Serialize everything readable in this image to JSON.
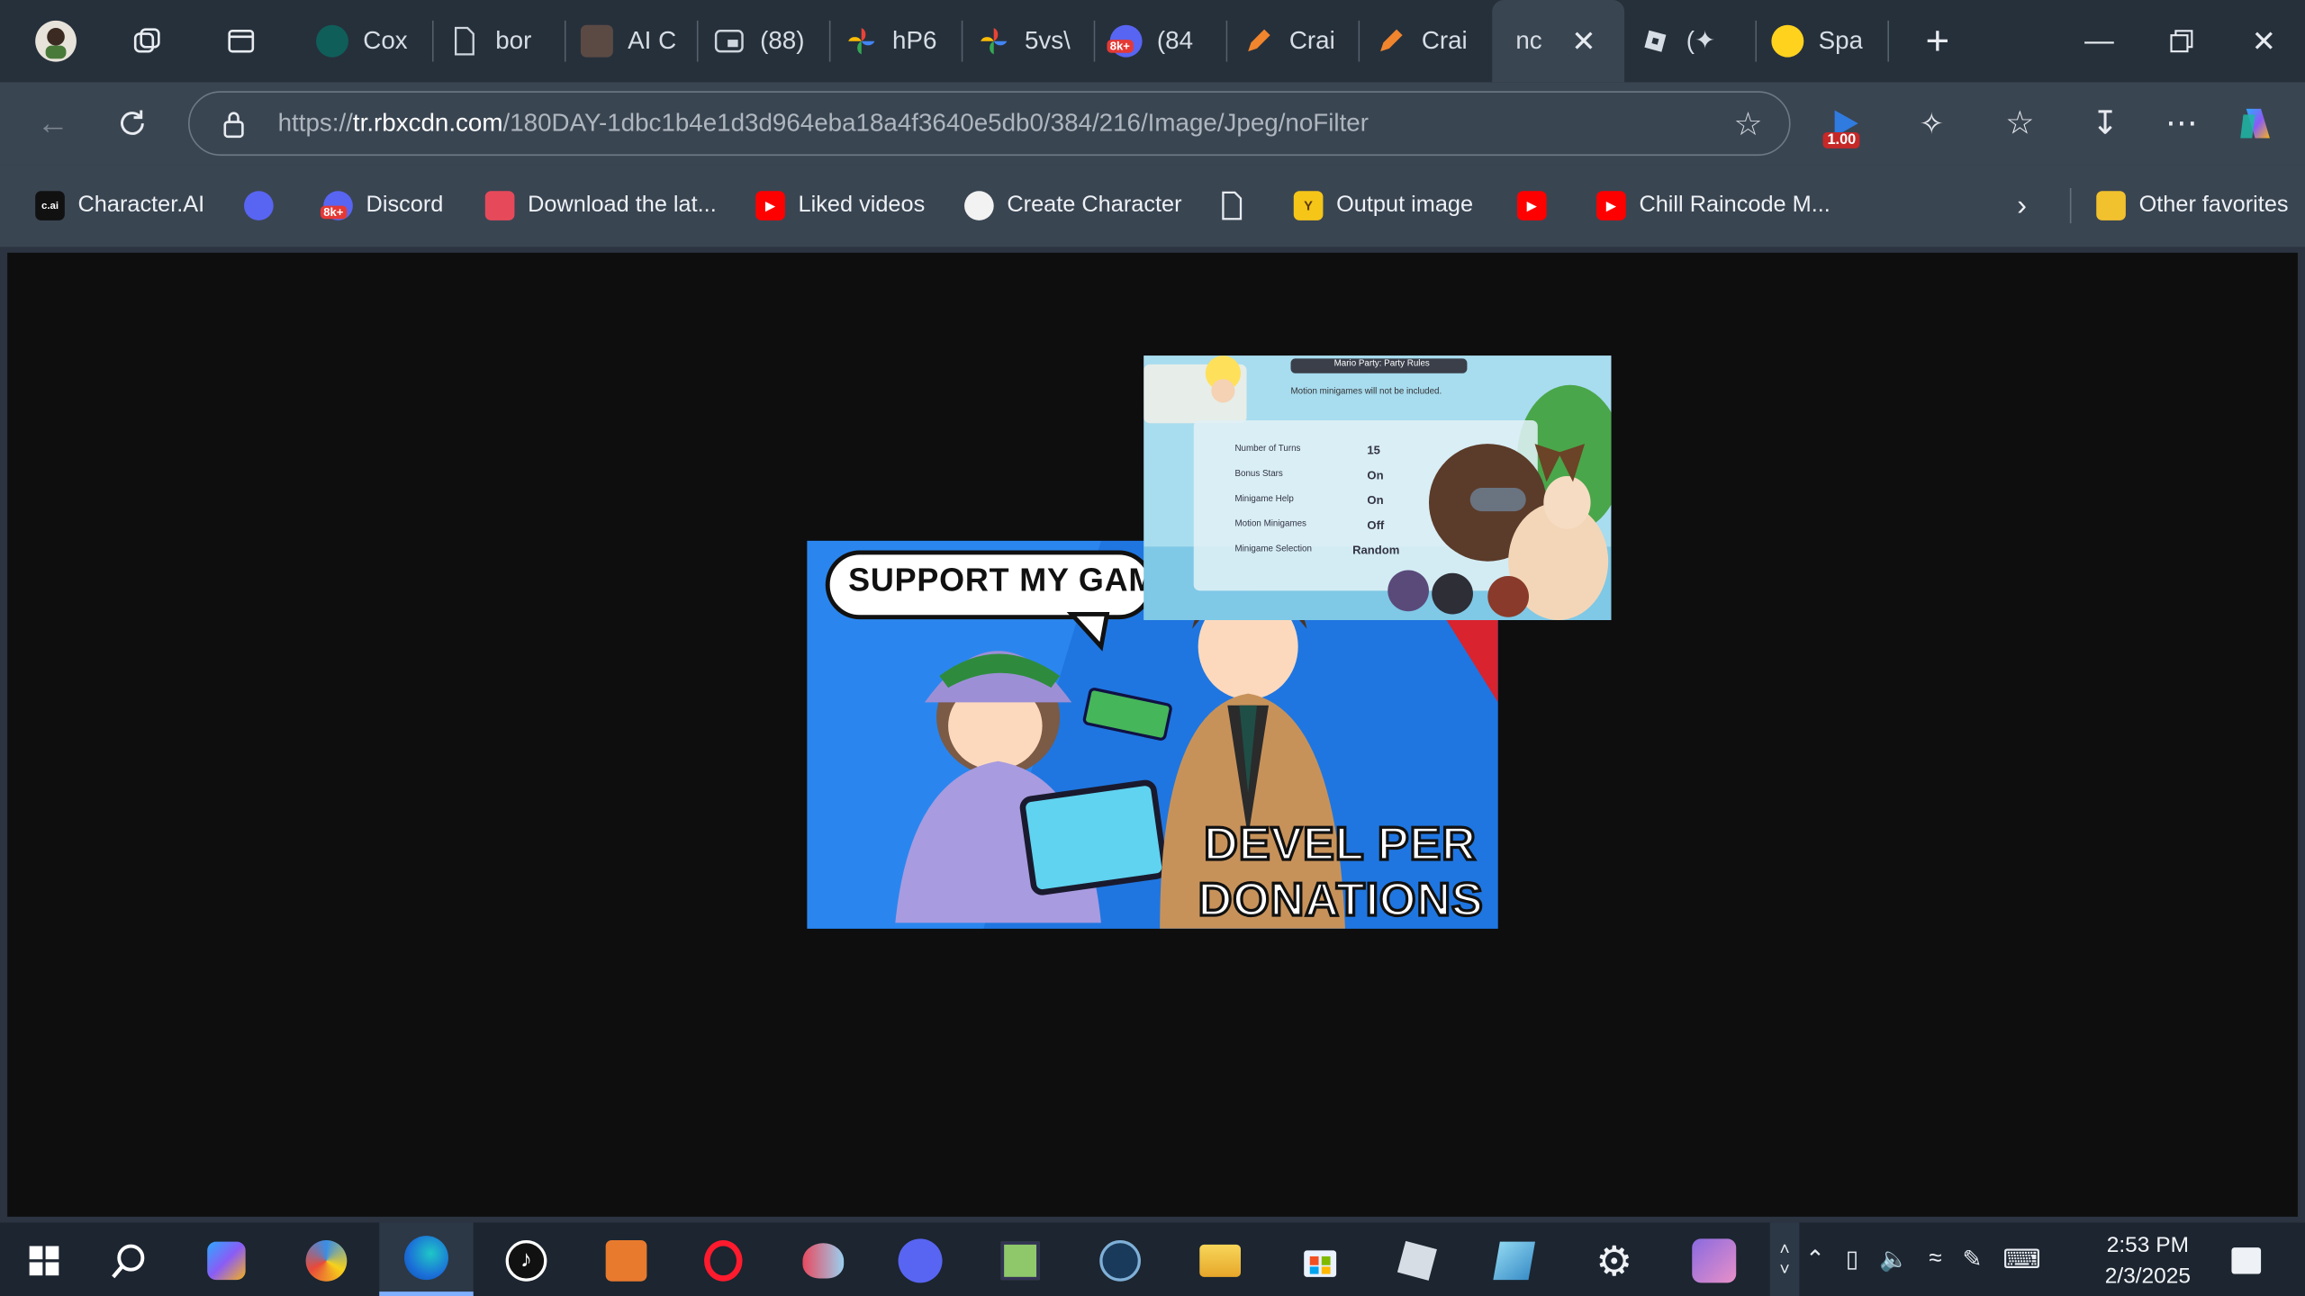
{
  "tabs": [
    {
      "title": "Cox",
      "icon": "circle-teal-icon"
    },
    {
      "title": "bor",
      "icon": "document-icon"
    },
    {
      "title": "AI C",
      "icon": "photo-thumb-icon"
    },
    {
      "title": "(88)",
      "icon": "picture-in-picture-icon"
    },
    {
      "title": "hP6",
      "icon": "pinwheel-icon"
    },
    {
      "title": "5vs\\",
      "icon": "pinwheel-icon"
    },
    {
      "title": "(84",
      "icon": "discord-badge-icon",
      "badge": "8k+"
    },
    {
      "title": "Crai",
      "icon": "pencil-icon"
    },
    {
      "title": "Crai",
      "icon": "pencil-icon"
    },
    {
      "title": "nc",
      "icon": "",
      "active": true
    },
    {
      "title": "(✦",
      "icon": "roblox-icon"
    },
    {
      "title": "Spa",
      "icon": "hugging-face-icon"
    }
  ],
  "address": {
    "url_prefix": "https://",
    "url_host": "tr.rbxcdn.com",
    "url_path": "/180DAY-1dbc1b4e1d3d964eba18a4f3640e5db0/384/216/Image/Jpeg/noFilter"
  },
  "extension_badge": "1.00",
  "bookmarks": [
    {
      "label": "Character.AI",
      "icon": "character-ai-icon",
      "icon_text": "c.ai"
    },
    {
      "label": "",
      "icon": "discord-icon"
    },
    {
      "label": "Discord",
      "icon": "discord-badge-icon",
      "badge": "8k+"
    },
    {
      "label": "Download the lat...",
      "icon": "store-icon"
    },
    {
      "label": "Liked videos",
      "icon": "youtube-icon"
    },
    {
      "label": "Create Character",
      "icon": "openai-icon"
    },
    {
      "label": "",
      "icon": "document-icon"
    },
    {
      "label": "Output image",
      "icon": "y-logo-icon"
    },
    {
      "label": "",
      "icon": "youtube-icon"
    },
    {
      "label": "Chill Raincode M...",
      "icon": "youtube-icon"
    },
    {
      "label": "Other favorites",
      "icon": "folder-icon"
    }
  ],
  "thumbnail": {
    "headline": "SUPPORT MY GAM",
    "footer_line1": "DEVEL PER",
    "footer_line2": "DONATIONS"
  },
  "game_overlay": {
    "title": "Mario Party: Party Rules",
    "subtitle": "Motion minigames will not be included.",
    "rows": [
      {
        "label": "Number of Turns",
        "value": "15"
      },
      {
        "label": "Bonus Stars",
        "value": "On"
      },
      {
        "label": "Minigame Help",
        "value": "On"
      },
      {
        "label": "Motion Minigames",
        "value": "Off"
      },
      {
        "label": "Minigame Selection",
        "value": "Random"
      }
    ]
  },
  "taskbar_apps": [
    "windows-start-icon",
    "search-icon",
    "copilot-icon",
    "paint-icon",
    "edge-icon",
    "tiktok-icon",
    "touch-app-icon",
    "opera-icon",
    "balloon-icon",
    "discord-icon",
    "drawing-app-icon",
    "steam-icon",
    "file-explorer-icon",
    "microsoft-store-icon",
    "roblox-icon",
    "notepad-icon",
    "settings-icon",
    "anime-app-icon"
  ],
  "clock": {
    "time": "2:53 PM",
    "date": "2/3/2025"
  },
  "colors": {
    "tabbar": "#26303b",
    "toolbar": "#3a4552",
    "content": "#0e0e0e",
    "taskbar": "#1c2530",
    "accent": "#2f7be0"
  }
}
